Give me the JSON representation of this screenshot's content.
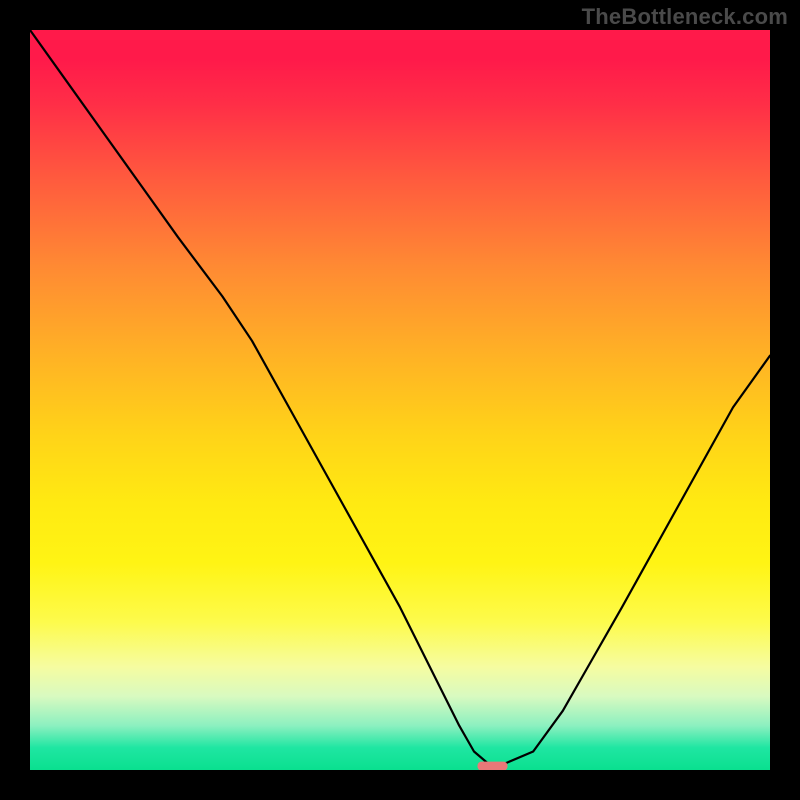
{
  "watermark": "TheBottleneck.com",
  "chart_data": {
    "type": "line",
    "title": "",
    "xlabel": "",
    "ylabel": "",
    "xlim": [
      0,
      100
    ],
    "ylim": [
      0,
      100
    ],
    "grid": false,
    "legend": false,
    "series": [
      {
        "name": "bottleneck-curve",
        "x": [
          0,
          5,
          10,
          15,
          20,
          23,
          26,
          30,
          35,
          40,
          45,
          50,
          55,
          58,
          60,
          62,
          64,
          68,
          72,
          76,
          80,
          85,
          90,
          95,
          100
        ],
        "values": [
          100,
          93,
          86,
          79,
          72,
          68,
          64,
          58,
          49,
          40,
          31,
          22,
          12,
          6,
          2.5,
          0.8,
          0.8,
          2.5,
          8,
          15,
          22,
          31,
          40,
          49,
          56
        ]
      }
    ],
    "marker": {
      "x": 62.5,
      "y": 0.6,
      "color": "#e97878"
    },
    "background_gradient": {
      "top": "#ff1a4a",
      "mid": "#ffe615",
      "bottom": "#0ae08f"
    }
  }
}
